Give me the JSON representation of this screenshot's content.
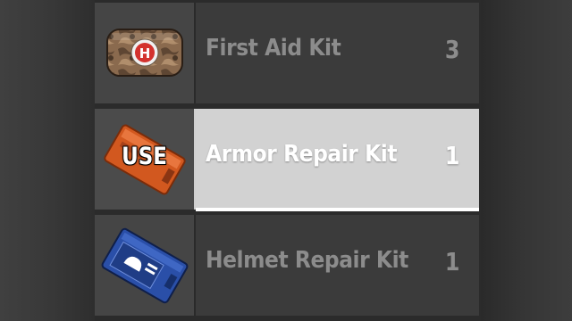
{
  "inventory": {
    "items": [
      {
        "name": "First Aid Kit",
        "quantity": "3",
        "icon": "first-aid-kit-icon"
      },
      {
        "name": "Armor Repair Kit",
        "quantity": "1",
        "icon": "armor-repair-kit-icon",
        "selected": true,
        "action_label": "USE"
      },
      {
        "name": "Helmet Repair Kit",
        "quantity": "1",
        "icon": "helmet-repair-kit-icon"
      }
    ]
  },
  "colors": {
    "selected_row": "#d2d2d2",
    "row": "#3b3b3b",
    "text_dim": "#8c8c8c",
    "text_selected": "#ffffff",
    "armor_kit": "#d2581f",
    "helmet_kit": "#2a4fa8"
  }
}
